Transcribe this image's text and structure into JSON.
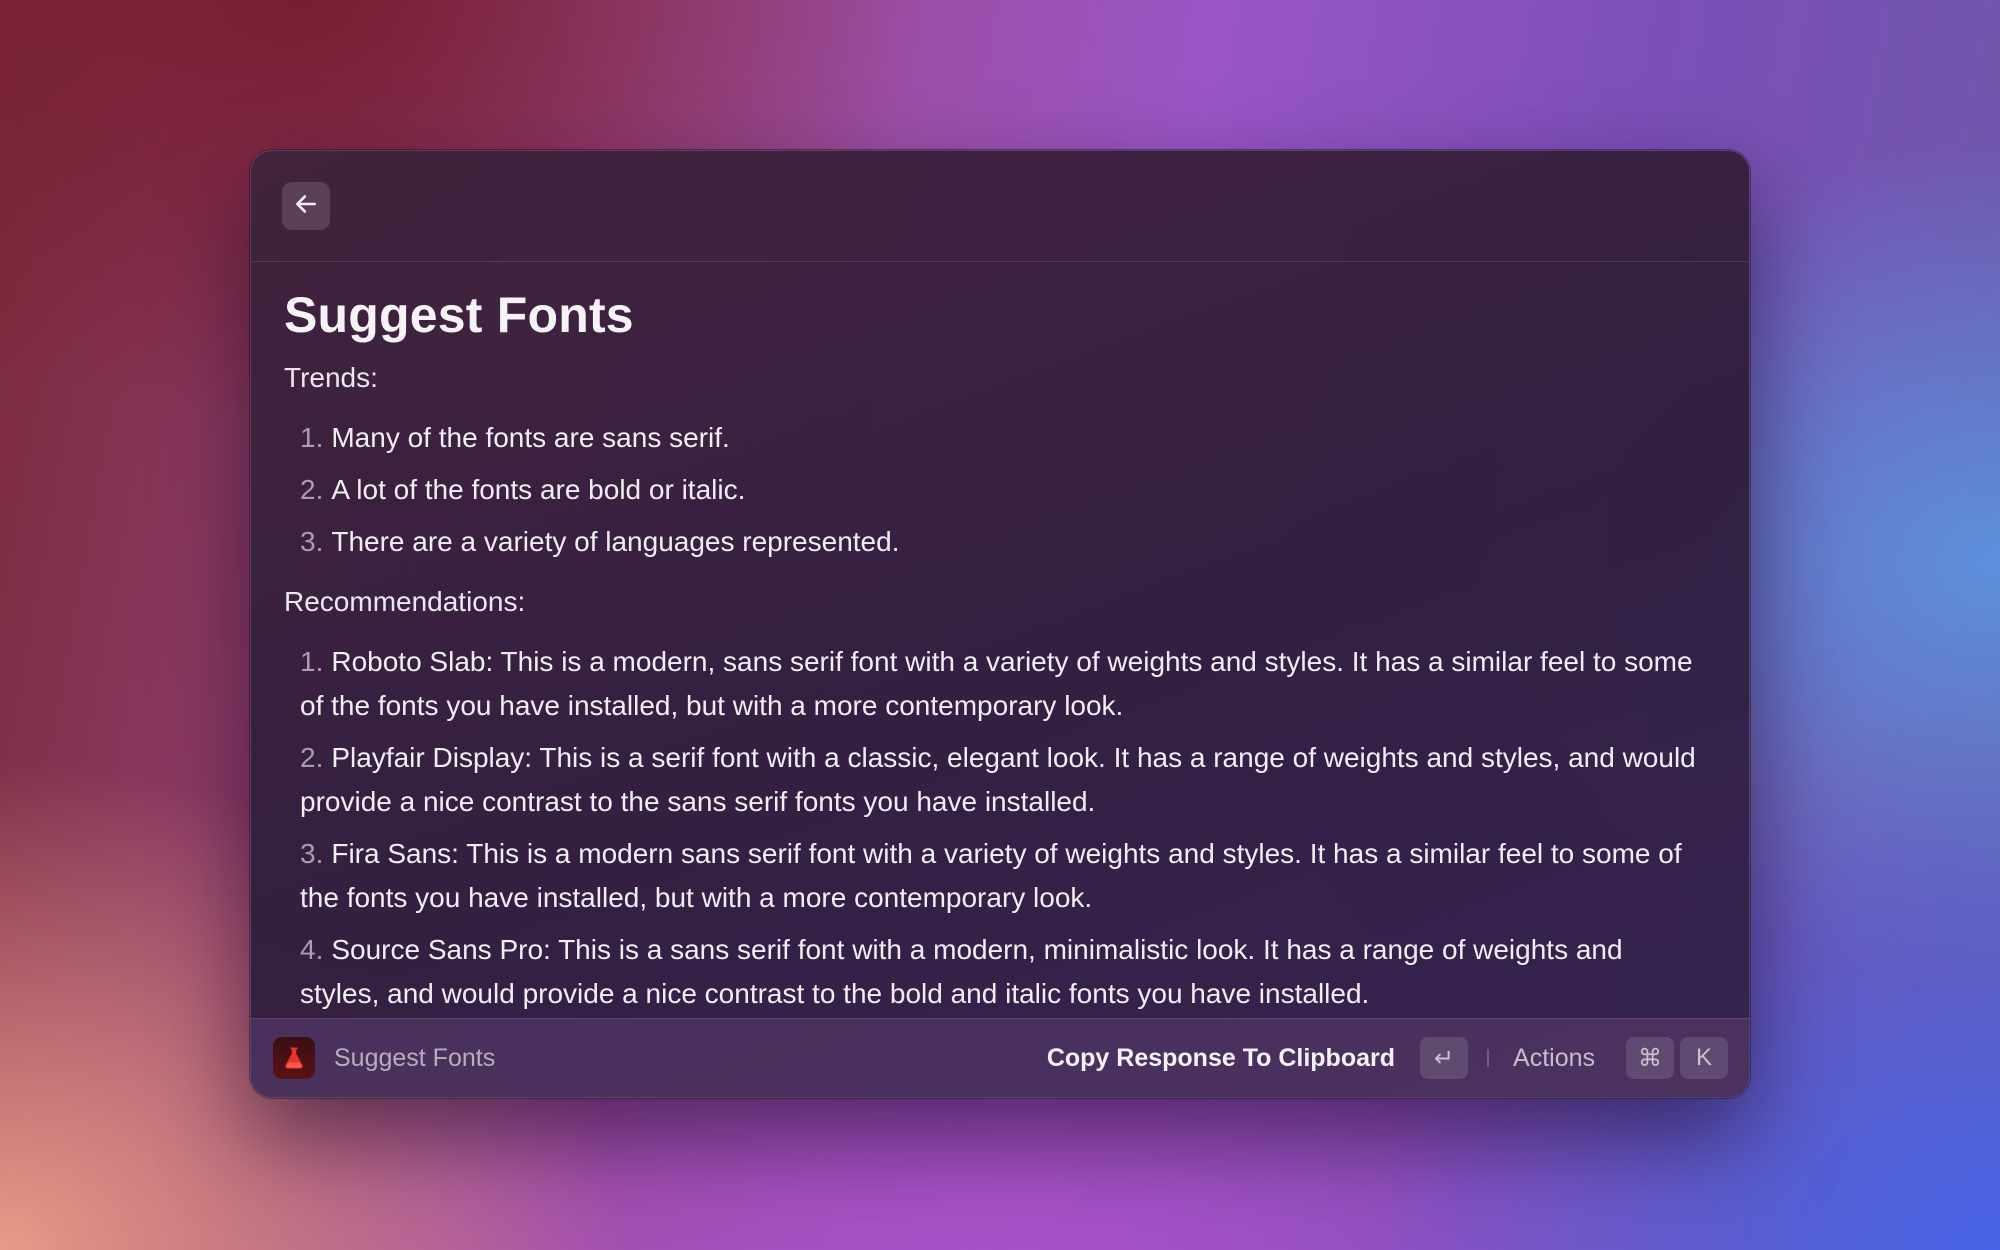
{
  "header": {
    "back_icon": "arrow-left-icon"
  },
  "main": {
    "title": "Suggest Fonts",
    "trends_label": "Trends:",
    "trends": [
      {
        "num": "1.",
        "text": "Many of the fonts are sans serif."
      },
      {
        "num": "2.",
        "text": "A lot of the fonts are bold or italic."
      },
      {
        "num": "3.",
        "text": "There are a variety of languages represented."
      }
    ],
    "recommendations_label": "Recommendations:",
    "recommendations": [
      {
        "num": "1.",
        "text": "Roboto Slab: This is a modern, sans serif font with a variety of weights and styles. It has a similar feel to some of the fonts you have installed, but with a more contemporary look."
      },
      {
        "num": "2.",
        "text": "Playfair Display: This is a serif font with a classic, elegant look. It has a range of weights and styles, and would provide a nice contrast to the sans serif fonts you have installed."
      },
      {
        "num": "3.",
        "text": "Fira Sans: This is a modern sans serif font with a variety of weights and styles. It has a similar feel to some of the fonts you have installed, but with a more contemporary look."
      },
      {
        "num": "4.",
        "text": "Source Sans Pro: This is a sans serif font with a modern, minimalistic look. It has a range of weights and styles, and would provide a nice contrast to the bold and italic fonts you have installed."
      }
    ]
  },
  "footer": {
    "app_icon": "flask-icon",
    "title": "Suggest Fonts",
    "primary_action": "Copy Response To Clipboard",
    "enter_key": "↵",
    "actions_label": "Actions",
    "cmd_key": "⌘",
    "k_key": "K"
  }
}
